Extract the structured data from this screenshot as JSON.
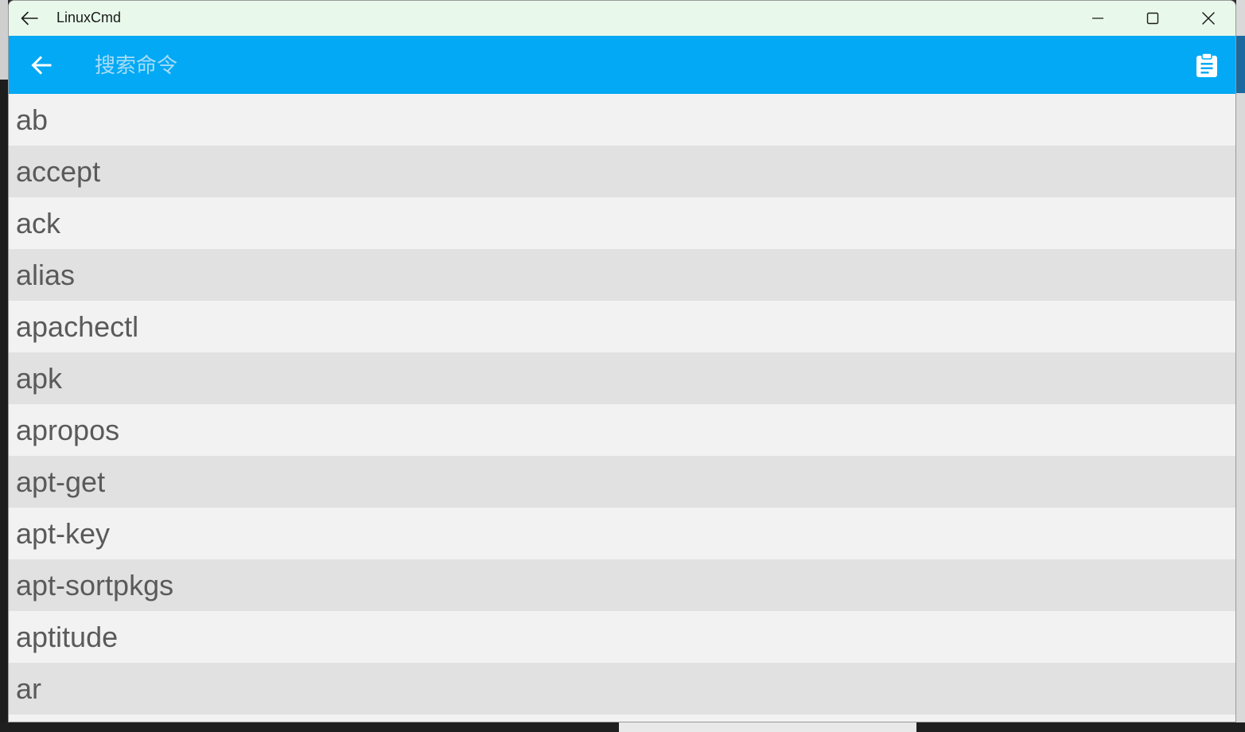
{
  "window": {
    "title": "LinuxCmd"
  },
  "search": {
    "placeholder": "搜索命令",
    "value": ""
  },
  "commands": [
    "ab",
    "accept",
    "ack",
    "alias",
    "apachectl",
    "apk",
    "apropos",
    "apt-get",
    "apt-key",
    "apt-sortpkgs",
    "aptitude",
    "ar"
  ],
  "colors": {
    "titlebar": "#e8f8ea",
    "appbar": "#03a9f4",
    "row_light": "#f2f2f2",
    "row_dark": "#e1e1e1"
  }
}
